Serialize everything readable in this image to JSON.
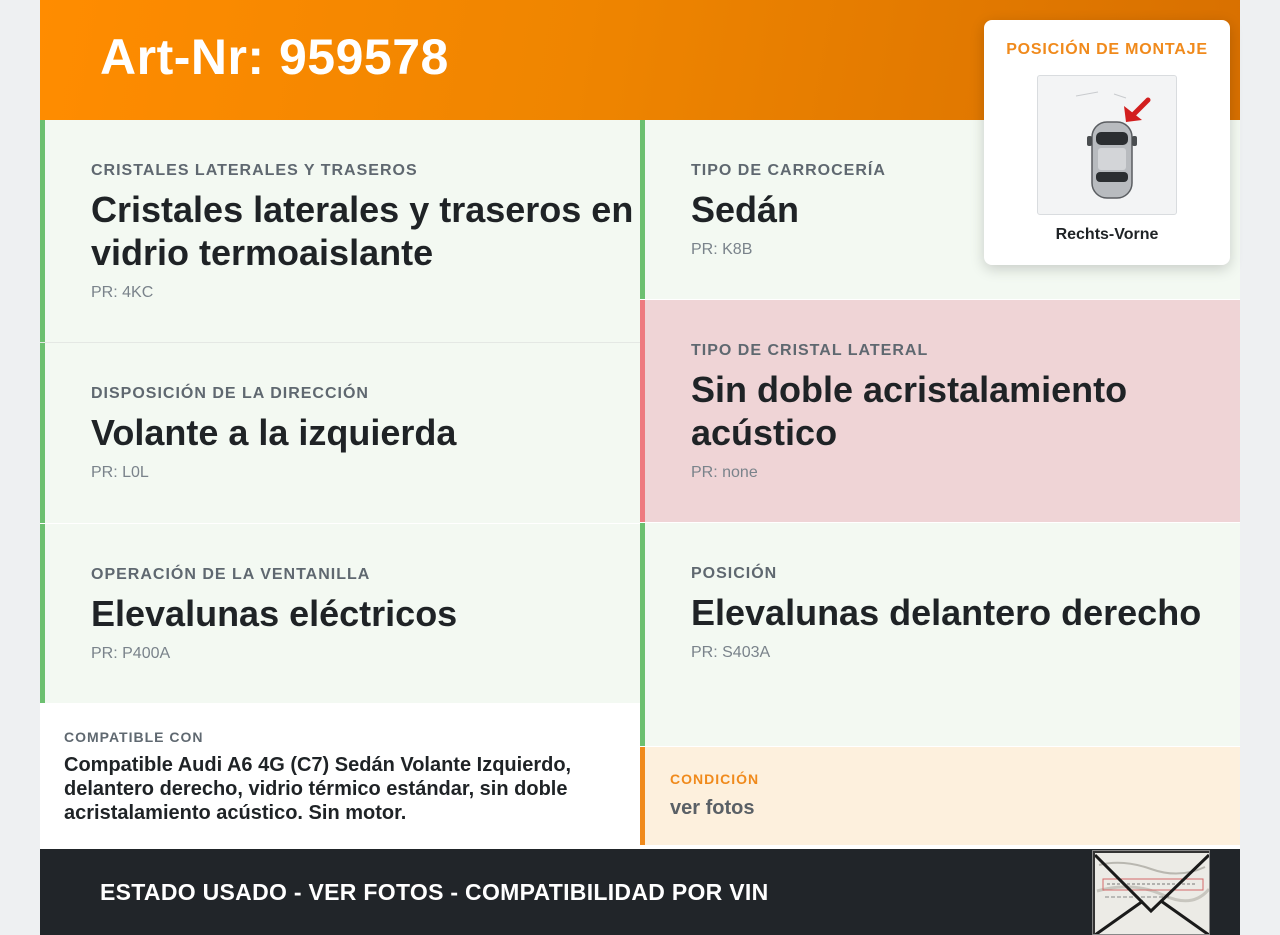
{
  "header": {
    "title": "Art-Nr: 959578"
  },
  "cells": [
    {
      "label": "CRISTALES LATERALES Y TRASEROS",
      "value": "Cristales laterales y traseros en vidrio termoaislante",
      "pr": "PR: 4KC",
      "status": "ok"
    },
    {
      "label": "DISPOSICIÓN DE LA DIRECCIÓN",
      "value": "Volante a la izquierda",
      "pr": "PR: L0L",
      "status": "ok"
    },
    {
      "label": "OPERACIÓN DE LA VENTANILLA",
      "value": "Elevalunas eléctricos",
      "pr": "PR: P400A",
      "status": "ok"
    },
    {
      "label": "TIPO DE CARROCERÍA",
      "value": "Sedán",
      "pr": "PR: K8B",
      "status": "ok"
    },
    {
      "label": "TIPO DE CRISTAL LATERAL",
      "value": "Sin doble acristalamiento acústico",
      "pr": "PR: none",
      "status": "warn"
    },
    {
      "label": "POSICIÓN",
      "value": "Elevalunas delantero derecho",
      "pr": "PR: S403A",
      "status": "ok"
    }
  ],
  "compat": {
    "label": "COMPATIBLE CON",
    "text": "Compatible Audi A6 4G (C7) Sedán Volante Izquierdo, delantero derecho, vidrio térmico estándar, sin doble acristalamiento acústico. Sin motor."
  },
  "condition": {
    "label": "CONDICIÓN",
    "text": "ver fotos"
  },
  "footer": {
    "text": "ESTADO USADO - VER FOTOS - COMPATIBILIDAD POR VIN"
  },
  "mount": {
    "title": "POSICIÓN DE MONTAJE",
    "caption": "Rechts-Vorne"
  },
  "colors": {
    "accent": "#ff8c00",
    "ok": "#6cc070",
    "warn": "#ee7a7f",
    "dark": "#212529"
  }
}
